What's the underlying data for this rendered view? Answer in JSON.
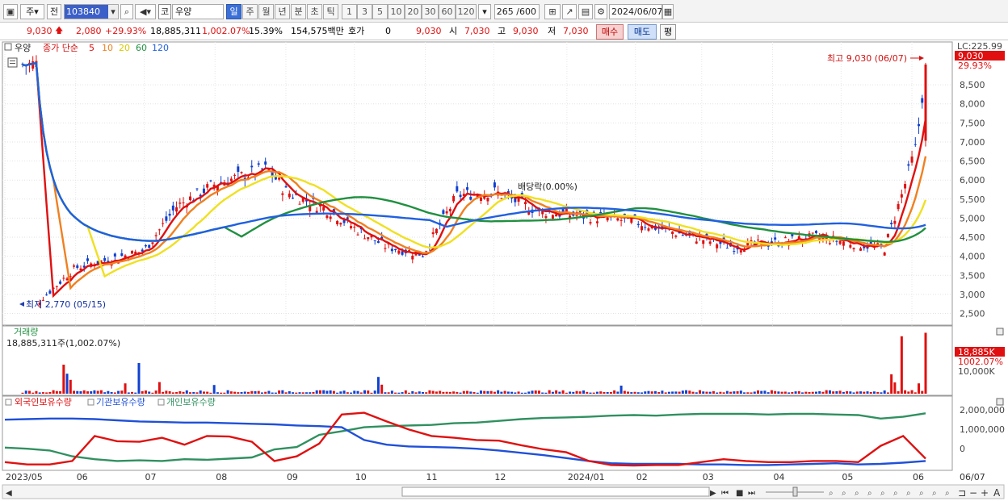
{
  "toolbar": {
    "market_type": "주",
    "prev_label": "전",
    "stock_code": "103840",
    "market_badge": "코",
    "stock_name": "우양",
    "periods": [
      "일",
      "주",
      "월",
      "년",
      "분",
      "초",
      "틱"
    ],
    "selected_period": "일",
    "intervals": [
      "1",
      "3",
      "5",
      "10",
      "20",
      "30",
      "60",
      "120"
    ],
    "bar_count": "265 /600",
    "date": "2024/06/07"
  },
  "quote": {
    "price": "9,030",
    "change": "2,080",
    "change_pct": "+29.93%",
    "volume": "18,885,311",
    "volume_pct": "1,002.07%",
    "turnover_pct": "15.39%",
    "amount": "154,575백만",
    "hoga_label": "호가",
    "hoga_value": "0",
    "current": "9,030",
    "open_label": "시",
    "open": "7,030",
    "high_label": "고",
    "high": "9,030",
    "low_label": "저",
    "low": "7,030",
    "buy_label": "매수",
    "sell_label": "매도",
    "pyeong_label": "평"
  },
  "price_panel": {
    "stock_tag": "우양",
    "legend_main": "종가 단순",
    "ma_labels": [
      "5",
      "10",
      "20",
      "60",
      "120"
    ],
    "ma_colors": [
      "#e01010",
      "#f08020",
      "#f0e020",
      "#209040",
      "#2060e0"
    ],
    "high_annotation": "최고 9,030 (06/07)",
    "low_annotation": "최저 2,770 (05/15)",
    "dividend_annotation": "배당락(0.00%)",
    "lc_label": "LC:225.99",
    "last_price_tag": "9,030",
    "last_pct_tag": "29.93%",
    "y_ticks": [
      "8,500",
      "8,000",
      "7,500",
      "7,000",
      "6,500",
      "6,000",
      "5,500",
      "5,000",
      "4,500",
      "4,000",
      "3,500",
      "3,000",
      "2,500"
    ]
  },
  "volume_panel": {
    "title": "거래량",
    "summary": "18,885,311주(1,002.07%)",
    "tag_value": "18,885K",
    "tag_pct": "1002.07%",
    "y_tick": "10,000K"
  },
  "holding_panel": {
    "legends": [
      "외국인보유수량",
      "기관보유수량",
      "개인보유수량"
    ],
    "legend_colors": [
      "#e01010",
      "#2050d8",
      "#309060"
    ],
    "y_ticks": [
      "2,000,000",
      "1,000,000",
      "0"
    ]
  },
  "x_axis": {
    "labels": [
      "2023/05",
      "06",
      "07",
      "08",
      "09",
      "10",
      "11",
      "12",
      "2024/01",
      "02",
      "03",
      "04",
      "05",
      "06"
    ],
    "right_label": "06/07"
  },
  "chart_data": {
    "type": "line",
    "title": "우양 (103840) 일봉",
    "x": [
      "2023-05-15",
      "2023-06-01",
      "2023-07-01",
      "2023-07-15",
      "2023-08-01",
      "2023-08-24",
      "2023-09-01",
      "2023-09-20",
      "2023-10-02",
      "2023-10-15",
      "2023-10-31",
      "2023-11-15",
      "2023-12-01",
      "2023-12-20",
      "2024-01-02",
      "2024-01-20",
      "2024-02-01",
      "2024-02-20",
      "2024-03-01",
      "2024-03-15",
      "2024-04-01",
      "2024-04-20",
      "2024-05-01",
      "2024-05-20",
      "2024-05-27",
      "2024-06-03",
      "2024-06-07"
    ],
    "series": [
      {
        "name": "종가",
        "values": [
          2770,
          3700,
          4150,
          5300,
          5900,
          6300,
          5700,
          5200,
          4700,
          4250,
          4050,
          5600,
          5700,
          5200,
          5100,
          5000,
          4900,
          4600,
          4450,
          4250,
          4350,
          4500,
          4400,
          4200,
          5500,
          6900,
          9030
        ]
      }
    ],
    "volume_events_k": [
      {
        "date": "2024-06-07",
        "volume_k": 18885
      },
      {
        "date": "2024-05-28",
        "volume_k": 17800
      }
    ],
    "ylabel": "",
    "ylim": [
      2300,
      9200
    ]
  }
}
